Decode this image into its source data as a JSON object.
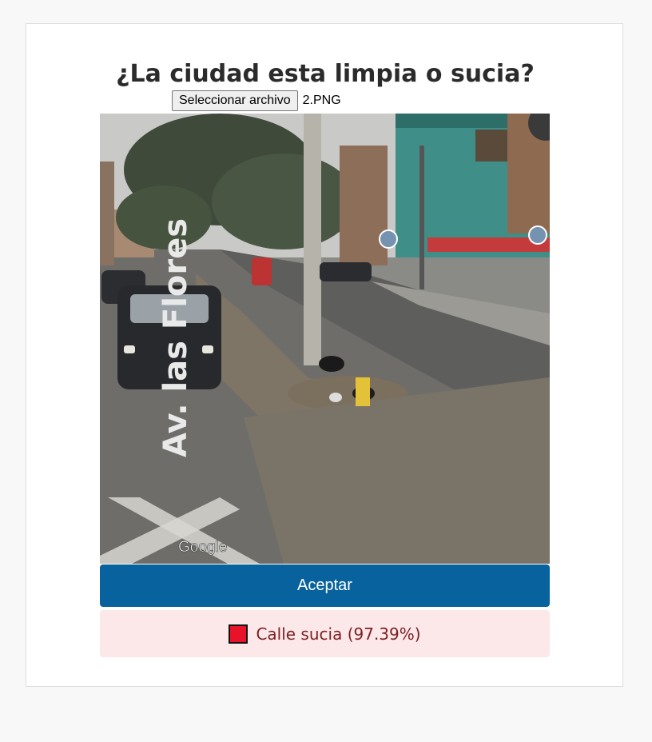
{
  "page": {
    "title": "¿La ciudad esta limpia o sucia?"
  },
  "upload": {
    "button_label": "Seleccionar archivo",
    "file_name": "2.PNG"
  },
  "photo": {
    "street_label": "Av. las Flores",
    "watermark": "Google"
  },
  "actions": {
    "accept_label": "Aceptar"
  },
  "result": {
    "text": "Calle sucia (97.39%)",
    "swatch_color": "#e8132a"
  },
  "colors": {
    "accept_button": "#07629d",
    "result_background": "#fce8e8",
    "result_text": "#7d1f22"
  }
}
